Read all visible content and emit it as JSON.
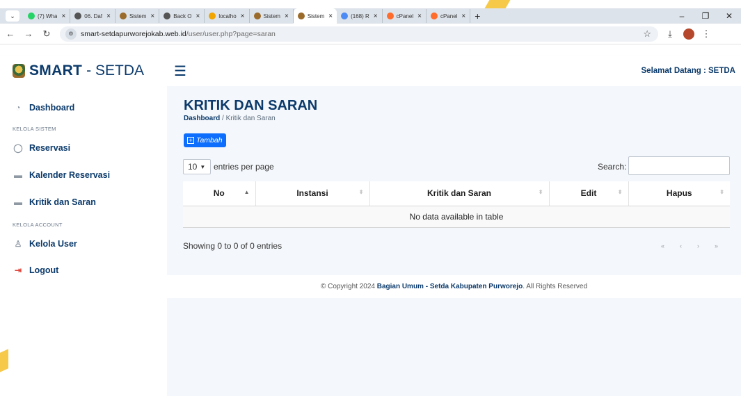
{
  "browser": {
    "tabs": [
      {
        "title": "(7) Wha",
        "favicon_color": "#25d366"
      },
      {
        "title": "06. Daf",
        "favicon_color": "#555555"
      },
      {
        "title": "Sistem",
        "favicon_color": "#9b6b2b"
      },
      {
        "title": "Back O",
        "favicon_color": "#555555"
      },
      {
        "title": "localho",
        "favicon_color": "#f0a500"
      },
      {
        "title": "Sistem",
        "favicon_color": "#9b6b2b"
      },
      {
        "title": "Sistem",
        "favicon_color": "#9b6b2b",
        "active": true
      },
      {
        "title": "(168) R",
        "favicon_color": "#4c8bf5"
      },
      {
        "title": "cPanel",
        "favicon_color": "#ff6c2c"
      },
      {
        "title": "cPanel",
        "favicon_color": "#ff6c2c"
      }
    ],
    "url_domain": "smart-setdapurworejokab.web.id",
    "url_path": "/user/user.php?page=saran"
  },
  "header": {
    "brand_bold": "SMART",
    "brand_rest": "- SETDA",
    "welcome": "Selamat Datang : SETDA"
  },
  "sidebar": {
    "dashboard": "Dashboard",
    "heading_sistem": "KELOLA SISTEM",
    "reservasi": "Reservasi",
    "kalender": "Kalender Reservasi",
    "kritik": "Kritik dan Saran",
    "heading_account": "KELOLA ACCOUNT",
    "kelola_user": "Kelola User",
    "logout": "Logout"
  },
  "main": {
    "title": "KRITIK DAN SARAN",
    "breadcrumb_home": "Dashboard",
    "breadcrumb_sep": "/",
    "breadcrumb_current": "Kritik dan Saran",
    "add_button": "Tambah",
    "entries_value": "10",
    "entries_suffix": "entries per page",
    "search_label": "Search:",
    "columns": [
      "No",
      "Instansi",
      "Kritik dan Saran",
      "Edit",
      "Hapus"
    ],
    "empty_message": "No data available in table",
    "info": "Showing 0 to 0 of 0 entries",
    "pager": [
      "«",
      "‹",
      "›",
      "»"
    ]
  },
  "footer": {
    "prefix": "© Copyright 2024",
    "org": "Bagian Umum - Setda Kabupaten Purworejo",
    "suffix": ". All Rights Reserved"
  }
}
